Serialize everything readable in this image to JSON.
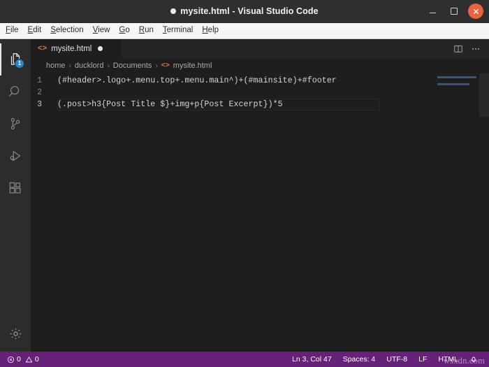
{
  "titlebar": {
    "title": "mysite.html - Visual Studio Code",
    "dirty_indicator": "dirty-dot",
    "controls": {
      "minimize": "minimize-icon",
      "maximize": "maximize-icon",
      "close": "close-icon"
    }
  },
  "menubar": {
    "items": [
      {
        "label": "File",
        "mnemonic": "F",
        "rest": "ile"
      },
      {
        "label": "Edit",
        "mnemonic": "E",
        "rest": "dit"
      },
      {
        "label": "Selection",
        "mnemonic": "S",
        "rest": "election"
      },
      {
        "label": "View",
        "mnemonic": "V",
        "rest": "iew"
      },
      {
        "label": "Go",
        "mnemonic": "G",
        "rest": "o"
      },
      {
        "label": "Run",
        "mnemonic": "R",
        "rest": "un"
      },
      {
        "label": "Terminal",
        "mnemonic": "T",
        "rest": "erminal"
      },
      {
        "label": "Help",
        "mnemonic": "H",
        "rest": "elp"
      }
    ]
  },
  "activitybar": {
    "items": [
      {
        "name": "explorer",
        "icon": "files-icon",
        "badge": "1",
        "active": true
      },
      {
        "name": "search",
        "icon": "search-icon",
        "badge": "",
        "active": false
      },
      {
        "name": "source-control",
        "icon": "source-control-icon",
        "badge": "",
        "active": false
      },
      {
        "name": "run-and-debug",
        "icon": "run-debug-icon",
        "badge": "",
        "active": false
      },
      {
        "name": "extensions",
        "icon": "extensions-icon",
        "badge": "",
        "active": false
      }
    ],
    "bottom": {
      "name": "manage",
      "icon": "gear-icon"
    }
  },
  "tabbar": {
    "tabs": [
      {
        "label": "mysite.html",
        "icon": "html-file-icon",
        "icon_glyph": "<>",
        "dirty": true,
        "active": true
      }
    ],
    "actions": [
      {
        "name": "split-editor",
        "icon": "split-editor-icon"
      },
      {
        "name": "more-actions",
        "icon": "ellipsis-icon",
        "glyph": "···"
      }
    ]
  },
  "breadcrumbs": {
    "separator": "›",
    "items": [
      {
        "label": "home",
        "icon": ""
      },
      {
        "label": "ducklord",
        "icon": ""
      },
      {
        "label": "Documents",
        "icon": ""
      },
      {
        "label": "mysite.html",
        "icon": "html-file-icon",
        "icon_glyph": "<>"
      }
    ]
  },
  "editor": {
    "lines": [
      {
        "number": "1",
        "text": "(#header>.logo+.menu.top+.menu.main^)+(#mainsite)+#footer",
        "current": false
      },
      {
        "number": "2",
        "text": "",
        "current": false
      },
      {
        "number": "3",
        "text": "(.post>h3{Post Title $}+img+p{Post Excerpt})*5",
        "current": true
      }
    ]
  },
  "statusbar": {
    "problems": {
      "errors_icon": "error-icon",
      "errors": "0",
      "warnings_icon": "warning-icon",
      "warnings": "0"
    },
    "right": [
      {
        "name": "cursor-position",
        "label": "Ln 3, Col 47"
      },
      {
        "name": "indentation",
        "label": "Spaces: 4"
      },
      {
        "name": "encoding",
        "label": "UTF-8"
      },
      {
        "name": "eol",
        "label": "LF"
      },
      {
        "name": "language-mode",
        "label": "HTML"
      },
      {
        "name": "notifications",
        "label": "",
        "icon": "bell-icon"
      }
    ]
  },
  "watermark": {
    "text": "wsxdn.com"
  },
  "colors": {
    "titlebar_bg": "#2f2f2f",
    "menubar_bg": "#f6f5f4",
    "activitybar_bg": "#2c2c2c",
    "tabbar_bg": "#252526",
    "editor_bg": "#1e1e1e",
    "statusbar_bg": "#68217a",
    "accent_badge": "#1f8ad2",
    "close_button": "#e8643c",
    "file_icon": "#e37933"
  }
}
